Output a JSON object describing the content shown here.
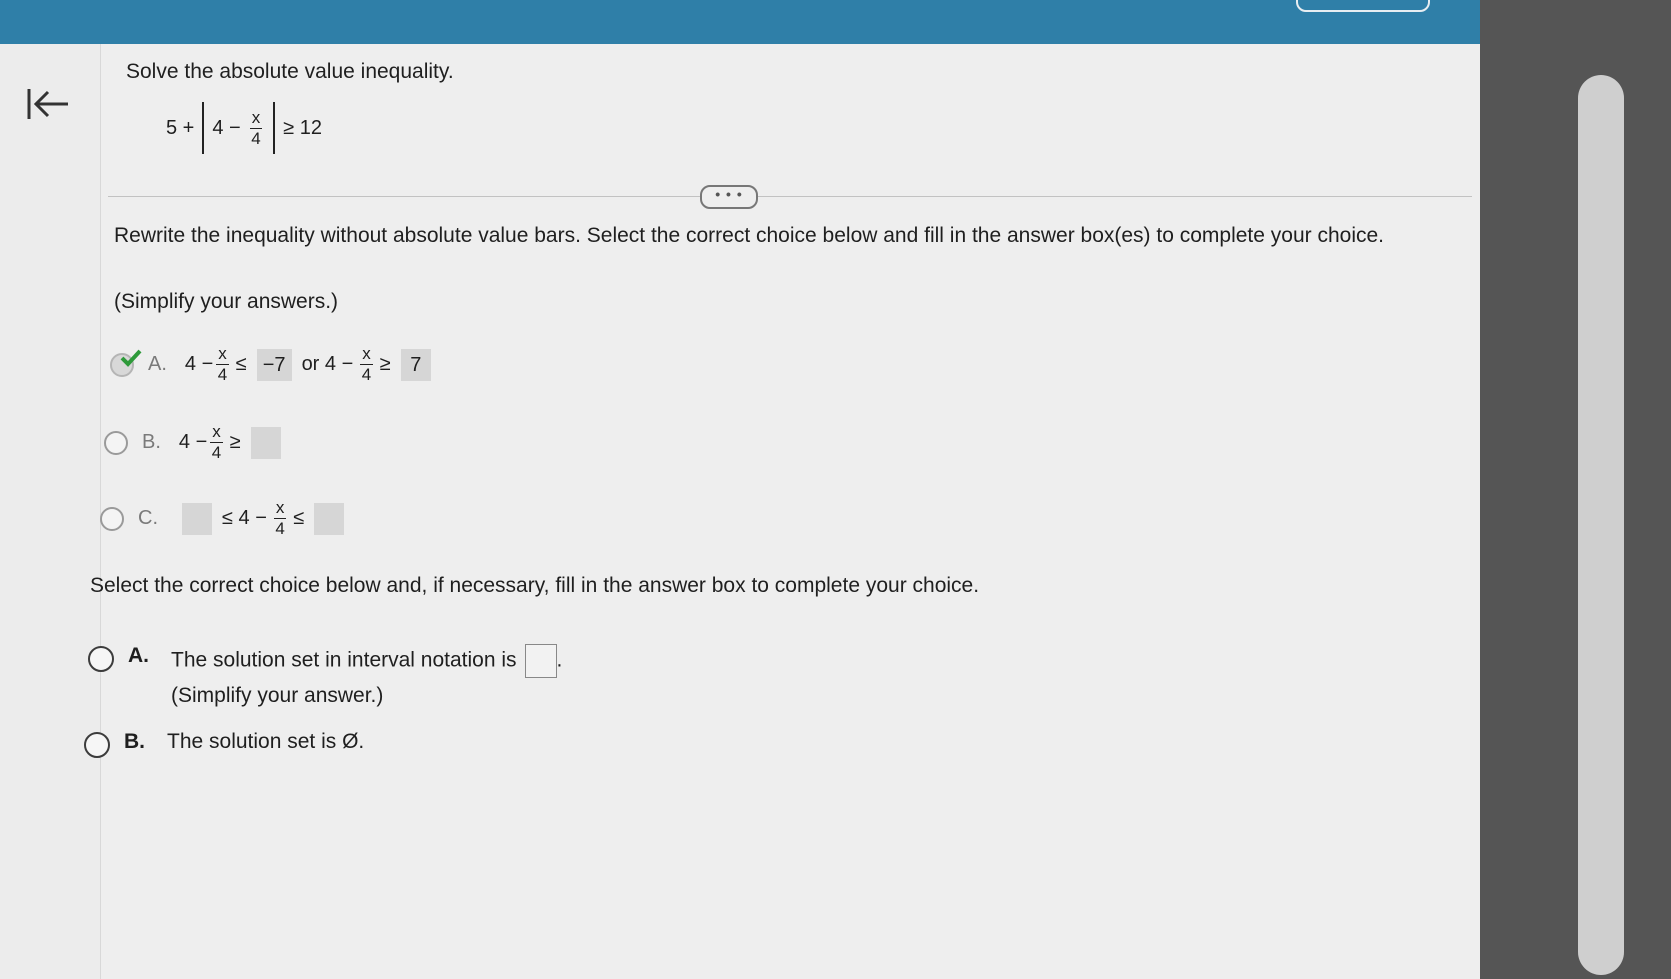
{
  "question": {
    "title": "Solve the absolute value inequality.",
    "expr": {
      "lead": "5 +",
      "inner_lead": "4 −",
      "frac_num": "x",
      "frac_den": "4",
      "trail": "≥ 12"
    }
  },
  "more_button_label": "• • •",
  "part1": {
    "instruction": "Rewrite the inequality without absolute value bars. Select the correct choice below and fill in the answer box(es) to complete your choice.",
    "note": "(Simplify your answers.)",
    "options": [
      {
        "letter": "A.",
        "lead": "4 −",
        "num": "x",
        "den": "4",
        "op1": "≤",
        "box1": "−7",
        "or": "or 4 −",
        "num2": "x",
        "den2": "4",
        "op2": "≥",
        "box2": "7",
        "selected": true
      },
      {
        "letter": "B.",
        "lead": "4 −",
        "num": "x",
        "den": "4",
        "op1": "≥",
        "box1": ""
      },
      {
        "letter": "C.",
        "box1": "",
        "op1": "≤ 4 −",
        "num": "x",
        "den": "4",
        "op2": "≤",
        "box2": ""
      }
    ]
  },
  "part2": {
    "instruction": "Select the correct choice below and, if necessary, fill in the answer box to complete your choice.",
    "options": [
      {
        "letter": "A.",
        "text": "The solution set in interval notation is",
        "suffix": ".",
        "note": "(Simplify your answer.)"
      },
      {
        "letter": "B.",
        "text": "The solution set is Ø."
      }
    ]
  },
  "colors": {
    "top_bar": "#2f7fa8",
    "check": "#2e9a3a",
    "answer_box": "#d6d6d6"
  }
}
